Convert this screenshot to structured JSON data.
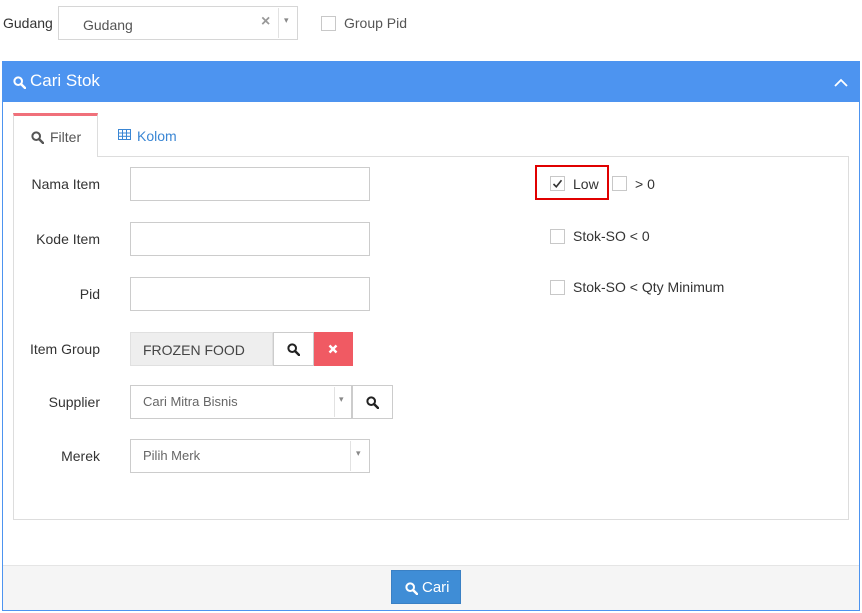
{
  "top": {
    "gudang_label": "Gudang",
    "gudang_value": "Gudang",
    "clear_glyph": "×",
    "caret_glyph": "▾",
    "group_pid_label": "Group Pid"
  },
  "panel": {
    "title": "Cari Stok",
    "accent_color": "#4d94f0",
    "collapse_glyph": "︿"
  },
  "tabs": [
    {
      "label": "Filter",
      "icon": "search-icon",
      "active": true
    },
    {
      "label": "Kolom",
      "icon": "table-icon",
      "active": false
    }
  ],
  "form": {
    "nama_item_label": "Nama Item",
    "kode_item_label": "Kode Item",
    "pid_label": "Pid",
    "item_group_label": "Item Group",
    "item_group_value": "FROZEN FOOD",
    "supplier_label": "Supplier",
    "supplier_placeholder": "Cari Mitra Bisnis",
    "merek_label": "Merek",
    "merek_placeholder": "Pilih Merk",
    "danger_color": "#f05a63"
  },
  "checks": {
    "low_label": "Low",
    "low_checked": true,
    "gt_zero_label": "> 0",
    "stok_so_lt_zero_label": "Stok-SO < 0",
    "stok_so_lt_qty_min_label": "Stok-SO < Qty Minimum",
    "highlight_color": "#e00000"
  },
  "footer": {
    "cari_label": "Cari",
    "button_color": "#3f8dd6"
  }
}
